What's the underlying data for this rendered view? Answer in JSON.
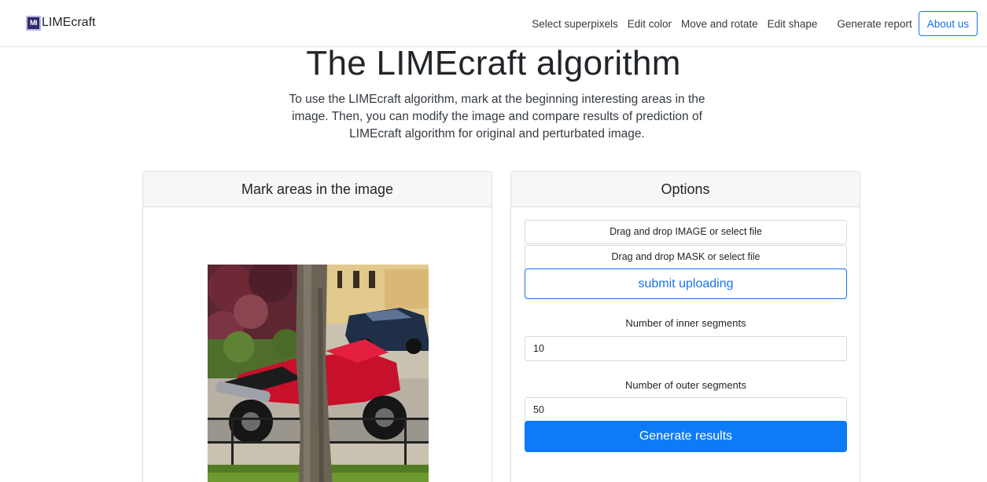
{
  "brand": {
    "logo_text": "MI",
    "name": "LIMEcraft"
  },
  "nav": {
    "items": [
      "Select superpixels",
      "Edit color",
      "Move and rotate",
      "Edit shape",
      "Generate report"
    ],
    "about_label": "About us"
  },
  "hero": {
    "title": "The LIMEcraft algorithm",
    "description": "To use the LIMEcraft algorithm, mark at the beginning interesting areas in the image. Then, you can modify the image and compare results of prediction of LIMEcraft algorithm for original and perturbated image."
  },
  "left_card": {
    "title": "Mark areas in the image"
  },
  "right_card": {
    "title": "Options",
    "image_drop_label": "Drag and drop IMAGE or select file",
    "mask_drop_label": "Drag and drop MASK or select file",
    "submit_label": "submit uploading",
    "inner_label": "Number of inner segments",
    "inner_value": "10",
    "outer_label": "Number of outer segments",
    "outer_value": "50",
    "generate_label": "Generate results"
  },
  "colors": {
    "accent": "#1a73e8",
    "primary_button": "#0d7bf6",
    "logo_bg": "#2e2a6b"
  }
}
